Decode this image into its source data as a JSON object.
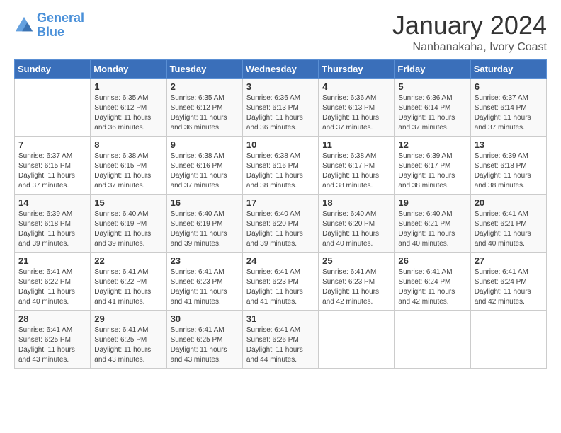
{
  "logo": {
    "line1": "General",
    "line2": "Blue"
  },
  "title": "January 2024",
  "location": "Nanbanakaha, Ivory Coast",
  "days_header": [
    "Sunday",
    "Monday",
    "Tuesday",
    "Wednesday",
    "Thursday",
    "Friday",
    "Saturday"
  ],
  "weeks": [
    [
      {
        "day": "",
        "info": ""
      },
      {
        "day": "1",
        "info": "Sunrise: 6:35 AM\nSunset: 6:12 PM\nDaylight: 11 hours\nand 36 minutes."
      },
      {
        "day": "2",
        "info": "Sunrise: 6:35 AM\nSunset: 6:12 PM\nDaylight: 11 hours\nand 36 minutes."
      },
      {
        "day": "3",
        "info": "Sunrise: 6:36 AM\nSunset: 6:13 PM\nDaylight: 11 hours\nand 36 minutes."
      },
      {
        "day": "4",
        "info": "Sunrise: 6:36 AM\nSunset: 6:13 PM\nDaylight: 11 hours\nand 37 minutes."
      },
      {
        "day": "5",
        "info": "Sunrise: 6:36 AM\nSunset: 6:14 PM\nDaylight: 11 hours\nand 37 minutes."
      },
      {
        "day": "6",
        "info": "Sunrise: 6:37 AM\nSunset: 6:14 PM\nDaylight: 11 hours\nand 37 minutes."
      }
    ],
    [
      {
        "day": "7",
        "info": "Sunrise: 6:37 AM\nSunset: 6:15 PM\nDaylight: 11 hours\nand 37 minutes."
      },
      {
        "day": "8",
        "info": "Sunrise: 6:38 AM\nSunset: 6:15 PM\nDaylight: 11 hours\nand 37 minutes."
      },
      {
        "day": "9",
        "info": "Sunrise: 6:38 AM\nSunset: 6:16 PM\nDaylight: 11 hours\nand 37 minutes."
      },
      {
        "day": "10",
        "info": "Sunrise: 6:38 AM\nSunset: 6:16 PM\nDaylight: 11 hours\nand 38 minutes."
      },
      {
        "day": "11",
        "info": "Sunrise: 6:38 AM\nSunset: 6:17 PM\nDaylight: 11 hours\nand 38 minutes."
      },
      {
        "day": "12",
        "info": "Sunrise: 6:39 AM\nSunset: 6:17 PM\nDaylight: 11 hours\nand 38 minutes."
      },
      {
        "day": "13",
        "info": "Sunrise: 6:39 AM\nSunset: 6:18 PM\nDaylight: 11 hours\nand 38 minutes."
      }
    ],
    [
      {
        "day": "14",
        "info": "Sunrise: 6:39 AM\nSunset: 6:18 PM\nDaylight: 11 hours\nand 39 minutes."
      },
      {
        "day": "15",
        "info": "Sunrise: 6:40 AM\nSunset: 6:19 PM\nDaylight: 11 hours\nand 39 minutes."
      },
      {
        "day": "16",
        "info": "Sunrise: 6:40 AM\nSunset: 6:19 PM\nDaylight: 11 hours\nand 39 minutes."
      },
      {
        "day": "17",
        "info": "Sunrise: 6:40 AM\nSunset: 6:20 PM\nDaylight: 11 hours\nand 39 minutes."
      },
      {
        "day": "18",
        "info": "Sunrise: 6:40 AM\nSunset: 6:20 PM\nDaylight: 11 hours\nand 40 minutes."
      },
      {
        "day": "19",
        "info": "Sunrise: 6:40 AM\nSunset: 6:21 PM\nDaylight: 11 hours\nand 40 minutes."
      },
      {
        "day": "20",
        "info": "Sunrise: 6:41 AM\nSunset: 6:21 PM\nDaylight: 11 hours\nand 40 minutes."
      }
    ],
    [
      {
        "day": "21",
        "info": "Sunrise: 6:41 AM\nSunset: 6:22 PM\nDaylight: 11 hours\nand 40 minutes."
      },
      {
        "day": "22",
        "info": "Sunrise: 6:41 AM\nSunset: 6:22 PM\nDaylight: 11 hours\nand 41 minutes."
      },
      {
        "day": "23",
        "info": "Sunrise: 6:41 AM\nSunset: 6:23 PM\nDaylight: 11 hours\nand 41 minutes."
      },
      {
        "day": "24",
        "info": "Sunrise: 6:41 AM\nSunset: 6:23 PM\nDaylight: 11 hours\nand 41 minutes."
      },
      {
        "day": "25",
        "info": "Sunrise: 6:41 AM\nSunset: 6:23 PM\nDaylight: 11 hours\nand 42 minutes."
      },
      {
        "day": "26",
        "info": "Sunrise: 6:41 AM\nSunset: 6:24 PM\nDaylight: 11 hours\nand 42 minutes."
      },
      {
        "day": "27",
        "info": "Sunrise: 6:41 AM\nSunset: 6:24 PM\nDaylight: 11 hours\nand 42 minutes."
      }
    ],
    [
      {
        "day": "28",
        "info": "Sunrise: 6:41 AM\nSunset: 6:25 PM\nDaylight: 11 hours\nand 43 minutes."
      },
      {
        "day": "29",
        "info": "Sunrise: 6:41 AM\nSunset: 6:25 PM\nDaylight: 11 hours\nand 43 minutes."
      },
      {
        "day": "30",
        "info": "Sunrise: 6:41 AM\nSunset: 6:25 PM\nDaylight: 11 hours\nand 43 minutes."
      },
      {
        "day": "31",
        "info": "Sunrise: 6:41 AM\nSunset: 6:26 PM\nDaylight: 11 hours\nand 44 minutes."
      },
      {
        "day": "",
        "info": ""
      },
      {
        "day": "",
        "info": ""
      },
      {
        "day": "",
        "info": ""
      }
    ]
  ]
}
